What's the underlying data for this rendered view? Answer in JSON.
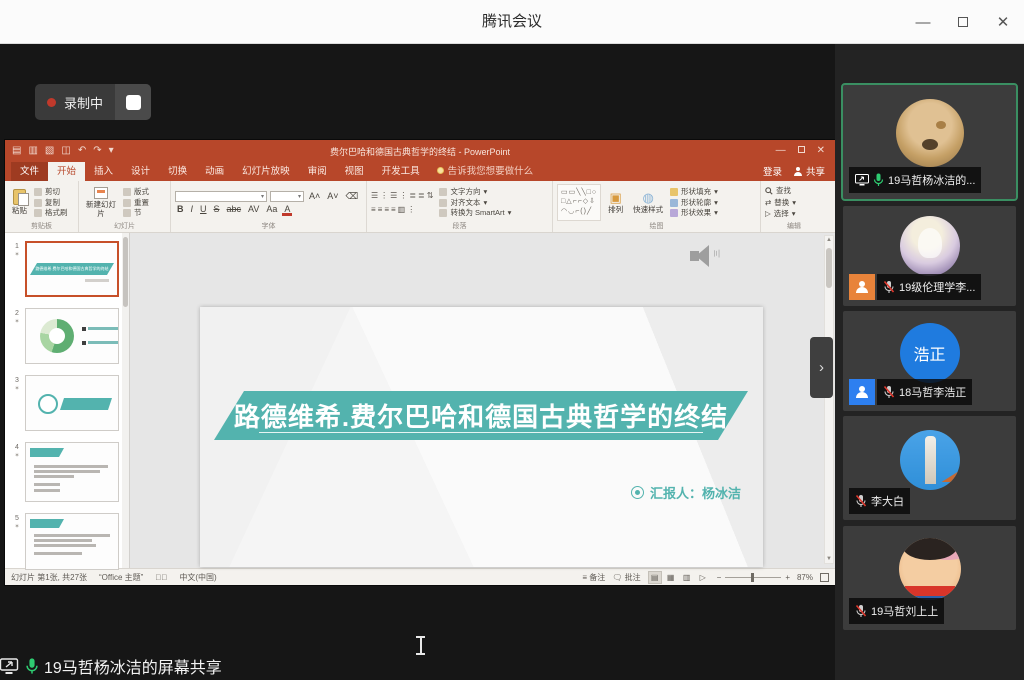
{
  "meeting": {
    "window_title": "腾讯会议",
    "recording_label": "录制中",
    "share_banner": "19马哲杨冰洁的屏幕共享",
    "participants": [
      {
        "name": "19马哲杨冰洁的...",
        "mic": "on",
        "sharing": true
      },
      {
        "name": "19级伦理学李...",
        "mic": "muted"
      },
      {
        "name": "18马哲李浩正",
        "mic": "muted",
        "avatar_text": "浩正"
      },
      {
        "name": "李大白",
        "mic": "muted"
      },
      {
        "name": "19马哲刘上上",
        "mic": "muted"
      }
    ]
  },
  "powerpoint": {
    "window_title": "费尔巴哈和德国古典哲学的终结 - PowerPoint",
    "tabs": [
      "文件",
      "开始",
      "插入",
      "设计",
      "切换",
      "动画",
      "幻灯片放映",
      "审阅",
      "视图",
      "开发工具"
    ],
    "tell_me": "告诉我您想要做什么",
    "account": {
      "signin": "登录",
      "share": "共享"
    },
    "ribbon": {
      "clipboard": {
        "label": "剪贴板",
        "paste": "粘贴",
        "cut": "剪切",
        "copy": "复制",
        "painter": "格式刷"
      },
      "slides": {
        "label": "幻灯片",
        "new_slide": "新建幻灯片",
        "layout": "版式",
        "reset": "重置",
        "section": "节"
      },
      "font": {
        "label": "字体",
        "bold": "B",
        "italic": "I",
        "underline": "U",
        "strike": "S",
        "abc": "abc",
        "av": "AV",
        "aa": "Aa",
        "color": "A"
      },
      "paragraph": {
        "label": "段落",
        "text_direction": "文字方向",
        "align_text": "对齐文本",
        "smartart": "转换为 SmartArt"
      },
      "drawing": {
        "label": "绘图",
        "arrange": "排列",
        "quick_styles": "快速样式",
        "shape_fill": "形状填充",
        "shape_outline": "形状轮廓",
        "shape_effects": "形状效果"
      },
      "editing": {
        "label": "编辑",
        "find": "查找",
        "replace": "替换",
        "select": "选择"
      }
    },
    "slide": {
      "title": "路德维希.费尔巴哈和德国古典哲学的终结",
      "presenter": "汇报人：杨冰洁"
    },
    "thumbnails": [
      {
        "number": "1"
      },
      {
        "number": "2"
      },
      {
        "number": "3"
      },
      {
        "number": "4"
      },
      {
        "number": "5"
      }
    ],
    "status": {
      "slide_info": "幻灯片 第1张, 共27张",
      "theme": "“Office 主题”",
      "language": "中文(中国)",
      "notes": "备注",
      "comments": "批注",
      "zoom_level": "87%"
    }
  },
  "colors": {
    "ppt_accent": "#b7472a",
    "slide_teal": "#53b3ae",
    "recording_red": "#c0392b",
    "mic_green": "#2ecc71",
    "active_tile_border": "#3a8f62"
  }
}
